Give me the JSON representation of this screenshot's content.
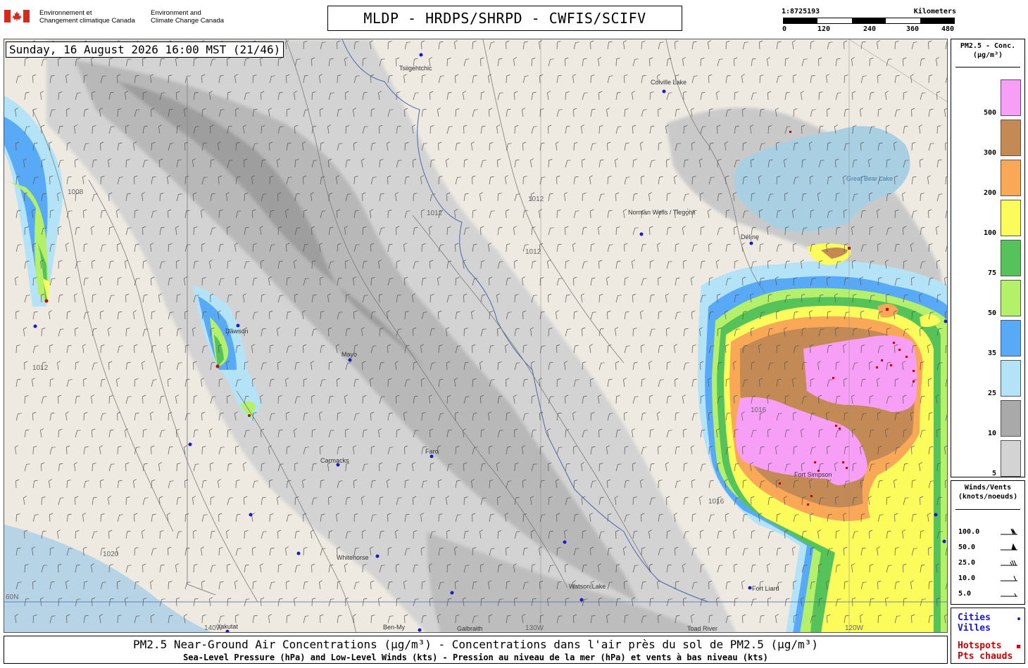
{
  "header": {
    "dept_fr": "Environnement et\nChangement climatique Canada",
    "dept_en": "Environment and\nClimate Change Canada",
    "title": "MLDP - HRDPS/SHRPD - CWFIS/SCIFV"
  },
  "scale": {
    "ratio": "1:8725193",
    "units": "Kilometers",
    "ticks": [
      "0",
      "120",
      "240",
      "360",
      "480"
    ]
  },
  "timestamp": "Sunday, 16 August 2026 16:00 MST (21/46)",
  "map": {
    "places": [
      "Tsiigehtchic",
      "Colville Lake",
      "Great Bear Lake",
      "Norman Wells / Tłegǫ́hłı",
      "Délı̨nę",
      "Dawson",
      "Mayo",
      "Faro",
      "Carmacks",
      "Whitehorse",
      "Watson Lake",
      "Fort Liard",
      "Fort Simpson",
      "Yakutat",
      "Toad River",
      "Ben-My",
      "Galbraith"
    ],
    "graticule": [
      "60N",
      "140W",
      "130W",
      "120W"
    ],
    "isobars": [
      "1008",
      "1012",
      "1016",
      "1020"
    ]
  },
  "legend_pm": {
    "title": "PM2.5 - Conc.\n(µg/m³)",
    "levels": [
      {
        "label": "500",
        "color": "#f79ef7"
      },
      {
        "label": "300",
        "color": "#c48a56"
      },
      {
        "label": "200",
        "color": "#f9a857"
      },
      {
        "label": "100",
        "color": "#fbfb5b"
      },
      {
        "label": "75",
        "color": "#56c35a"
      },
      {
        "label": "50",
        "color": "#b4f06a"
      },
      {
        "label": "35",
        "color": "#58a9f6"
      },
      {
        "label": "25",
        "color": "#b4e3f7"
      },
      {
        "label": "10",
        "color": "#a9a9a9"
      },
      {
        "label": "5",
        "color": "#d3d3d3"
      }
    ]
  },
  "legend_wind": {
    "title": "Winds/Vents\n(knots/noeuds)",
    "speeds": [
      "100.0",
      "50.0",
      "25.0",
      "10.0",
      "5.0"
    ]
  },
  "legend_points": {
    "cities_en": "Cities",
    "cities_fr": "Villes",
    "hotspots_en": "Hotspots",
    "hotspots_fr": "Pts chauds",
    "city_color": "#1a1acc",
    "hotspot_color": "#cc0000"
  },
  "footer": {
    "line1": "PM2.5 Near-Ground Air Concentrations (µg/m³) - Concentrations dans l'air près du sol de PM2.5 (µg/m³)",
    "line2": "Sea-Level Pressure (hPa) and Low-Level Winds (kts) - Pression au niveau de la mer (hPa) et vents à bas niveau (kts)"
  }
}
